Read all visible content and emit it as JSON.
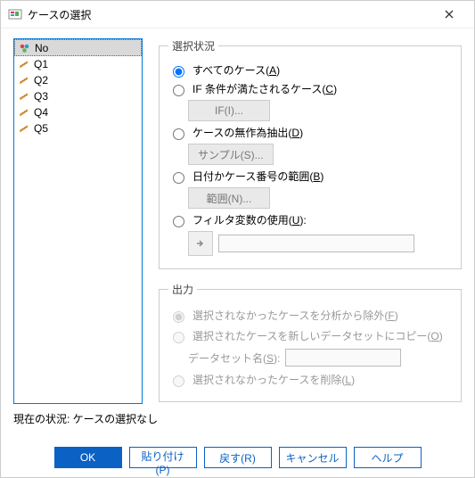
{
  "window": {
    "title": "ケースの選択"
  },
  "variables": [
    {
      "name": "No",
      "type": "nominal",
      "selected": true
    },
    {
      "name": "Q1",
      "type": "scale",
      "selected": false
    },
    {
      "name": "Q2",
      "type": "scale",
      "selected": false
    },
    {
      "name": "Q3",
      "type": "scale",
      "selected": false
    },
    {
      "name": "Q4",
      "type": "scale",
      "selected": false
    },
    {
      "name": "Q5",
      "type": "scale",
      "selected": false
    }
  ],
  "selection": {
    "legend": "選択状況",
    "opts": {
      "all": {
        "pre": "すべてのケース(",
        "mn": "A",
        "post": ")",
        "checked": true
      },
      "ifcond": {
        "pre": "IF 条件が満たされるケース(",
        "mn": "C",
        "post": ")",
        "button": "IF(I)..."
      },
      "random": {
        "pre": "ケースの無作為抽出(",
        "mn": "D",
        "post": ")",
        "button": "サンプル(S)..."
      },
      "range": {
        "pre": "日付かケース番号の範囲(",
        "mn": "B",
        "post": ")",
        "button": "範囲(N)..."
      },
      "filter": {
        "pre": "フィルタ変数の使用(",
        "mn": "U",
        "post": "):"
      }
    }
  },
  "output": {
    "legend": "出力",
    "opts": {
      "exclude": {
        "pre": "選択されなかったケースを分析から除外(",
        "mn": "F",
        "post": ")",
        "checked": true
      },
      "copy": {
        "pre": "選択されたケースを新しいデータセットにコピー(",
        "mn": "O",
        "post": ")"
      },
      "dsname": {
        "pre": "データセット名(",
        "mn": "S",
        "post": "):"
      },
      "delete": {
        "pre": "選択されなかったケースを削除(",
        "mn": "L",
        "post": ")"
      }
    }
  },
  "status": "現在の状況: ケースの選択なし",
  "buttons": {
    "ok": "OK",
    "paste": "貼り付け(P)",
    "reset": "戻す(R)",
    "cancel": "キャンセル",
    "help": "ヘルプ"
  }
}
